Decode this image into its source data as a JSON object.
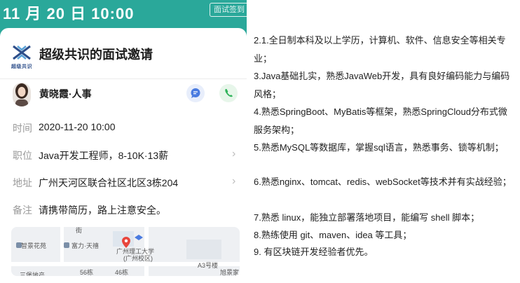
{
  "status_bar": {
    "date": "11 月 20 日 10:00",
    "sign_label": "面试签到"
  },
  "invite": {
    "logo_text": "超级共识",
    "title": "超级共识的面试邀请",
    "contact_name": "黄晓霞·人事",
    "time_label": "时间",
    "time_value": "2020-11-20 10:00",
    "position_label": "职位",
    "position_value": "Java开发工程师，8-10K·13薪",
    "address_label": "地址",
    "address_value": "广州天河区联合社区北区3栋204",
    "note_label": "备注",
    "note_value": "请携带简历，路上注意安全。"
  },
  "map": {
    "labels": [
      "街",
      "智景花苑",
      "富力·天禧",
      "广州理工大学",
      "(广州校区)",
      "A3号楼",
      "旭景家",
      "56栋",
      "46栋",
      "三堡地产"
    ]
  },
  "requirements": [
    "2.1.全日制本科及以上学历，计算机、软件、信息安全等相关专业；",
    "3.Java基础扎实，熟悉JavaWeb开发，具有良好编码能力与编码风格；",
    "4.熟悉SpringBoot、MyBatis等框架，熟悉SpringCloud分布式微服务架构；",
    "5.熟悉MySQL等数据库，掌握sql语言，熟悉事务、锁等机制；",
    "6.熟悉nginx、tomcat、redis、webSocket等技术并有实战经验；",
    "7.熟悉 linux，能独立部署落地项目，能编写 shell 脚本；",
    "8.熟练使用 git、maven、idea 等工具；",
    "9. 有区块链开发经验者优先。"
  ],
  "colors": {
    "header_teal": "#2aa89a",
    "chat_blue": "#4a7be0",
    "phone_green": "#2fb35a",
    "pin_red": "#e8453c"
  }
}
